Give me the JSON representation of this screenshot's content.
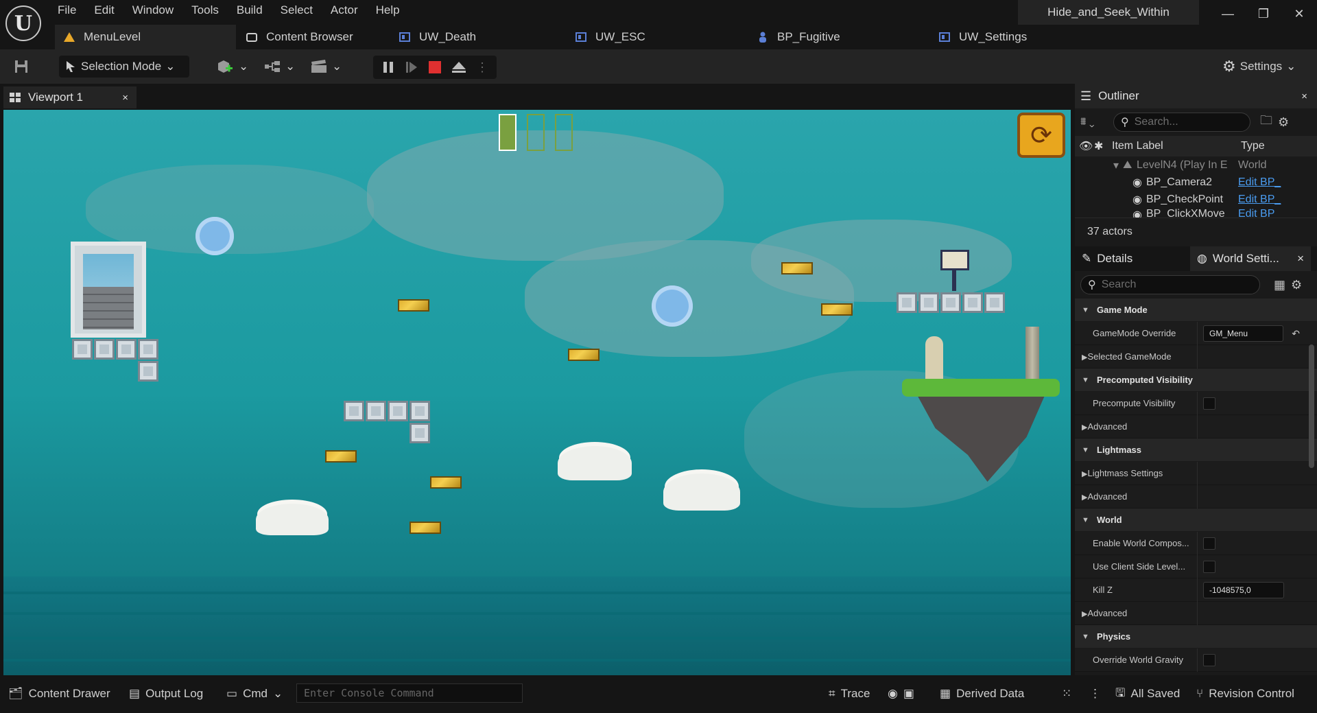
{
  "app": {
    "project_name": "Hide_and_Seek_Within"
  },
  "menu": [
    "File",
    "Edit",
    "Window",
    "Tools",
    "Build",
    "Select",
    "Actor",
    "Help"
  ],
  "window_controls": {
    "minimize": "—",
    "restore": "❐",
    "close": "✕"
  },
  "tabs": [
    {
      "label": "MenuLevel",
      "icon": "level-icon"
    },
    {
      "label": "Content Browser",
      "icon": "content-browser-icon"
    },
    {
      "label": "UW_Death",
      "icon": "widget-blueprint-icon"
    },
    {
      "label": "UW_ESC",
      "icon": "widget-blueprint-icon"
    },
    {
      "label": "BP_Fugitive",
      "icon": "character-blueprint-icon"
    },
    {
      "label": "UW_Settings",
      "icon": "widget-blueprint-icon"
    }
  ],
  "toolbar": {
    "selection_mode": "Selection Mode",
    "settings": "Settings"
  },
  "viewport": {
    "tab_label": "Viewport 1",
    "close": "×"
  },
  "outliner": {
    "title": "Outliner",
    "close": "×",
    "search_placeholder": "Search...",
    "columns": {
      "label": "Item Label",
      "type": "Type"
    },
    "rows": [
      {
        "label": "LevelN4 (Play In E",
        "type": "World",
        "indent": 0
      },
      {
        "label": "BP_Camera2",
        "type": "Edit BP_",
        "indent": 1
      },
      {
        "label": "BP_CheckPoint",
        "type": "Edit BP_",
        "indent": 1
      },
      {
        "label": "BP_ClickXMove",
        "type": "Edit BP_",
        "indent": 1
      }
    ],
    "actor_count": "37 actors"
  },
  "details": {
    "title": "Details",
    "world_settings_tab": "World Setti...",
    "close": "×",
    "search_placeholder": "Search",
    "sections": [
      {
        "type": "cat",
        "label": "Game Mode"
      },
      {
        "type": "prop",
        "label": "GameMode Override",
        "value": "GM_Menu",
        "kind": "text"
      },
      {
        "type": "sub",
        "label": "Selected GameMode"
      },
      {
        "type": "cat",
        "label": "Precomputed Visibility"
      },
      {
        "type": "prop",
        "label": "Precompute Visibility",
        "kind": "check"
      },
      {
        "type": "sub",
        "label": "Advanced"
      },
      {
        "type": "cat",
        "label": "Lightmass"
      },
      {
        "type": "sub",
        "label": "Lightmass Settings"
      },
      {
        "type": "sub",
        "label": "Advanced"
      },
      {
        "type": "cat",
        "label": "World"
      },
      {
        "type": "prop",
        "label": "Enable World Compos...",
        "kind": "check"
      },
      {
        "type": "prop",
        "label": "Use Client Side Level...",
        "kind": "check"
      },
      {
        "type": "prop",
        "label": "Kill Z",
        "value": "-1048575,0",
        "kind": "text"
      },
      {
        "type": "sub",
        "label": "Advanced"
      },
      {
        "type": "cat",
        "label": "Physics"
      },
      {
        "type": "prop",
        "label": "Override World Gravity",
        "kind": "check"
      }
    ]
  },
  "statusbar": {
    "content_drawer": "Content Drawer",
    "output_log": "Output Log",
    "cmd": "Cmd",
    "console_placeholder": "Enter Console Command",
    "trace": "Trace",
    "derived_data": "Derived Data",
    "all_saved": "All Saved",
    "revision_control": "Revision Control"
  },
  "colors": {
    "accent": "#4a9cf0",
    "stop": "#e03030",
    "level_tab_icon": "#e8a82a"
  }
}
